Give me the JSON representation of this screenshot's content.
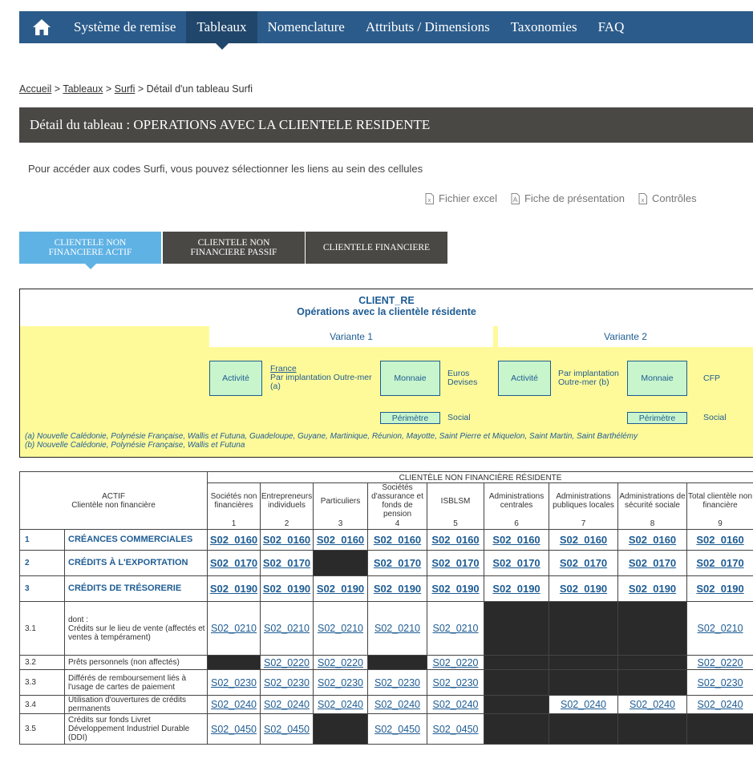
{
  "nav": {
    "items": [
      "Système de remise",
      "Tableaux",
      "Nomenclature",
      "Attributs / Dimensions",
      "Taxonomies",
      "FAQ"
    ],
    "active_index": 1
  },
  "breadcrumb": {
    "home": "Accueil",
    "sep": ">",
    "tables": "Tableaux",
    "surfi": "Surfi",
    "current": "Détail d'un tableau Surfi"
  },
  "detail_title": "Détail du tableau : OPERATIONS AVEC LA CLIENTELE RESIDENTE",
  "intro": "Pour accéder aux codes Surfi, vous pouvez sélectionner les liens au sein des cellules",
  "files": {
    "excel": "Fichier excel",
    "presentation": "Fiche de présentation",
    "controls": "Contrôles"
  },
  "tabs": [
    {
      "line1": "CLIENTELE NON",
      "line2": "FINANCIERE ACTIF",
      "active": true
    },
    {
      "line1": "CLIENTELE NON",
      "line2": "FINANCIERE PASSIF",
      "active": false
    },
    {
      "line1": "CLIENTELE FINANCIERE",
      "line2": "",
      "active": false
    }
  ],
  "header": {
    "code": "CLIENT_RE",
    "title": "Opérations avec la clientèle résidente",
    "variant1": "Variante 1",
    "variant2": "Variante 2",
    "v1": {
      "activite": "Activité",
      "france": "France",
      "outremer": "Par implantation Outre-mer",
      "note_a": "(a)",
      "monnaie": "Monnaie",
      "euros": "Euros",
      "devises": "Devises",
      "perimetre": "Périmètre",
      "social": "Social"
    },
    "v2": {
      "activite": "Activité",
      "impl1": "Par implantation",
      "impl2": "Outre-mer (b)",
      "monnaie": "Monnaie",
      "cfp": "CFP",
      "perimetre": "Périmètre",
      "social": "Social"
    },
    "note_a": "(a) Nouvelle Calédonie, Polynésie Française, Wallis et Futuna, Guadeloupe, Guyane, Martinique, Réunion, Mayotte, Saint Pierre et Miquelon, Saint Martin, Saint Barthélémy",
    "note_b": "(b) Nouvelle Calédonie, Polynésie Française, Wallis et Futuna"
  },
  "table": {
    "actif_title": "ACTIF",
    "actif_sub": "Clientèle non financière",
    "group": "CLIENTÈLE NON FINANCIÈRE RÉSIDENTE",
    "columns": [
      {
        "label": "Sociétés non financières",
        "num": "1"
      },
      {
        "label": "Entrepreneurs individuels",
        "num": "2"
      },
      {
        "label": "Particuliers",
        "num": "3"
      },
      {
        "label": "Sociétés d'assurance et fonds de pension",
        "num": "4"
      },
      {
        "label": "ISBLSM",
        "num": "5"
      },
      {
        "label": "Administrations centrales",
        "num": "6"
      },
      {
        "label": "Administrations publiques locales",
        "num": "7"
      },
      {
        "label": "Administrations de sécurité sociale",
        "num": "8"
      },
      {
        "label": "Total clientèle non financière",
        "num": "9"
      }
    ],
    "rows": [
      {
        "num": "1",
        "label": "CRÉANCES COMMERCIALES",
        "main": true,
        "cells": [
          "S02_0160",
          "S02_0160",
          "S02_0160",
          "S02_0160",
          "S02_0160",
          "S02_0160",
          "S02_0160",
          "S02_0160",
          "S02_0160"
        ]
      },
      {
        "num": "2",
        "label": "CRÉDITS À L'EXPORTATION",
        "main": true,
        "cells": [
          "S02_0170",
          "S02_0170",
          "",
          "S02_0170",
          "S02_0170",
          "S02_0170",
          "S02_0170",
          "S02_0170",
          "S02_0170"
        ]
      },
      {
        "num": "3",
        "label": "CRÉDITS DE TRÉSORERIE",
        "main": true,
        "cells": [
          "S02_0190",
          "S02_0190",
          "S02_0190",
          "S02_0190",
          "S02_0190",
          "S02_0190",
          "S02_0190",
          "S02_0190",
          "S02_0190"
        ]
      },
      {
        "num": "3.1",
        "label": "dont :\nCrédits sur le lieu de vente (affectés et ventes à tempérament)",
        "main": false,
        "cells": [
          "S02_0210",
          "S02_0210",
          "S02_0210",
          "S02_0210",
          "S02_0210",
          "",
          "",
          "",
          "S02_0210"
        ]
      },
      {
        "num": "3.2",
        "label": "Prêts personnels (non affectés)",
        "main": false,
        "cells": [
          "",
          "S02_0220",
          "S02_0220",
          "",
          "S02_0220",
          "",
          "",
          "",
          "S02_0220"
        ]
      },
      {
        "num": "3.3",
        "label": "Différés de remboursement liés à l'usage de cartes de paiement",
        "main": false,
        "cells": [
          "S02_0230",
          "S02_0230",
          "S02_0230",
          "S02_0230",
          "S02_0230",
          "",
          "",
          "",
          "S02_0230"
        ]
      },
      {
        "num": "3.4",
        "label": "Utilisation d'ouvertures de crédits permanents",
        "main": false,
        "cells": [
          "S02_0240",
          "S02_0240",
          "S02_0240",
          "S02_0240",
          "S02_0240",
          "",
          "S02_0240",
          "S02_0240",
          "S02_0240"
        ]
      },
      {
        "num": "3.5",
        "label": "Crédits sur fonds Livret Développement Industriel Durable (DDI)",
        "main": false,
        "cells": [
          "S02_0450",
          "S02_0450",
          "",
          "S02_0450",
          "S02_0450",
          "",
          "",
          "",
          ""
        ]
      }
    ]
  }
}
